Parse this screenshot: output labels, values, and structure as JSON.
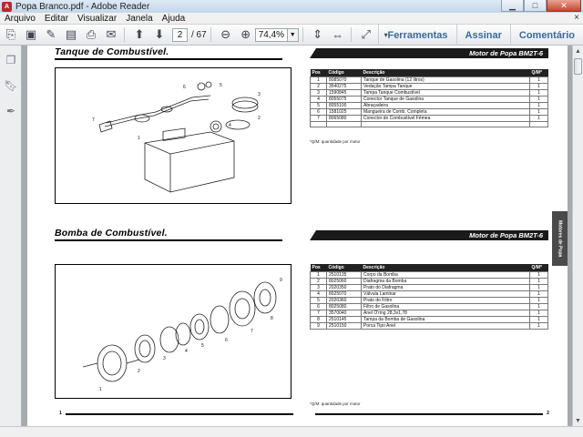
{
  "window": {
    "title": "Popa Branco.pdf - Adobe Reader",
    "icon": "adobe-reader-icon",
    "controls": [
      "minimize",
      "maximize",
      "close"
    ]
  },
  "menu": {
    "items": [
      "Arquivo",
      "Editar",
      "Visualizar",
      "Janela",
      "Ajuda"
    ],
    "close_glyph": "×"
  },
  "toolbar": {
    "current_page": "2",
    "total_pages": "/ 67",
    "zoom": "74,4%",
    "tools": "Ferramentas",
    "sign": "Assinar",
    "comment": "Comentário"
  },
  "section1": {
    "title": "Tanque de Combustível.",
    "model": "Motor de Popa BM2T-6",
    "headers": [
      "Pos",
      "Código",
      "Descrição",
      "Q/M*"
    ],
    "rows": [
      [
        "1",
        "8085070",
        "Tanque de Gasolina (12 litros)",
        "1"
      ],
      [
        "2",
        "3540275",
        "Vedação Tampa Tanque",
        "1"
      ],
      [
        "3",
        "1590845",
        "Tampa Tanque Combustível",
        "1"
      ],
      [
        "4",
        "8055075",
        "Conector Tanque de Gasolina",
        "1"
      ],
      [
        "5",
        "8055100",
        "Abraçadeira",
        "1"
      ],
      [
        "6",
        "1581025",
        "Mangueira de Comb. Completa",
        "1"
      ],
      [
        "7",
        "8065080",
        "Conector de Combustível Fêmea",
        "1"
      ]
    ],
    "footnote": "*Q/M: quantidade por motor"
  },
  "section2": {
    "title": "Bomba de Combustível.",
    "model": "Motor de Popa BM2T-6",
    "headers": [
      "Pos",
      "Código",
      "Descrição",
      "Q/M*"
    ],
    "rows": [
      [
        "1",
        "2510135",
        "Corpo da Bomba",
        "1"
      ],
      [
        "2",
        "8025060",
        "Diafragma da Bomba",
        "1"
      ],
      [
        "3",
        "2020350",
        "Prato do Diafragma",
        "1"
      ],
      [
        "4",
        "8025070",
        "Válvula Laminar",
        "1"
      ],
      [
        "5",
        "2020360",
        "Prato do Filtro",
        "1"
      ],
      [
        "6",
        "8025080",
        "Filtro de Gasolina",
        "1"
      ],
      [
        "7",
        "3570040",
        "Anel O'ring 28,3x1,78",
        "1"
      ],
      [
        "8",
        "2510145",
        "Tampa da Bomba de Gasolina",
        "1"
      ],
      [
        "9",
        "2510150",
        "Porca Tipo Anel",
        "1"
      ]
    ],
    "footnote": "*Q/M: quantidade por motor"
  },
  "side_tab": "Motores de Popa",
  "page_numbers": {
    "left": "1",
    "right": "2"
  }
}
